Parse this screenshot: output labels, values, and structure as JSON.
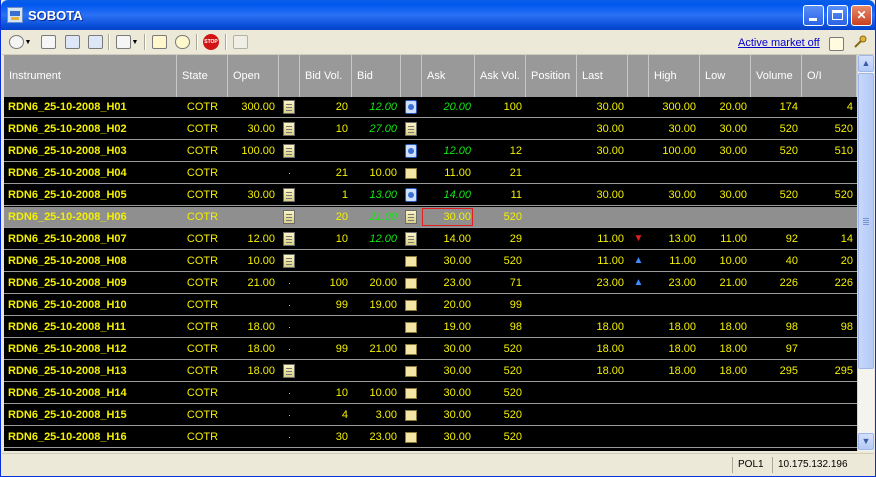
{
  "window": {
    "title": "SOBOTA"
  },
  "toolbar": {
    "active_market_link": "Active market off"
  },
  "columns": [
    "Instrument",
    "State",
    "Open",
    "",
    "Bid Vol.",
    "Bid",
    "",
    "Ask",
    "Ask Vol.",
    "Position",
    "Last",
    "",
    "High",
    "Low",
    "Volume",
    "O/I"
  ],
  "rows": [
    {
      "instrument": "RDN6_25-10-2008_H01",
      "state": "COTR",
      "open": "300.00",
      "open_icon": "doc",
      "bid_vol": "20",
      "bid": "12.00",
      "bid_green": true,
      "bid_icon": "binoc",
      "ask": "20.00",
      "ask_green": true,
      "ask_vol": "100",
      "position": "",
      "last": "30.00",
      "arrow": "",
      "high": "300.00",
      "low": "20.00",
      "volume": "174",
      "oi": "4"
    },
    {
      "instrument": "RDN6_25-10-2008_H02",
      "state": "COTR",
      "open": "30.00",
      "open_icon": "doc",
      "bid_vol": "10",
      "bid": "27.00",
      "bid_green": true,
      "bid_icon": "doc",
      "ask": "",
      "ask_green": false,
      "ask_vol": "",
      "position": "",
      "last": "30.00",
      "arrow": "",
      "high": "30.00",
      "low": "30.00",
      "volume": "520",
      "oi": "520"
    },
    {
      "instrument": "RDN6_25-10-2008_H03",
      "state": "COTR",
      "open": "100.00",
      "open_icon": "doc",
      "bid_vol": "",
      "bid": "",
      "bid_green": false,
      "bid_icon": "binoc",
      "ask": "12.00",
      "ask_green": true,
      "ask_vol": "12",
      "position": "",
      "last": "30.00",
      "arrow": "",
      "high": "100.00",
      "low": "30.00",
      "volume": "520",
      "oi": "510"
    },
    {
      "instrument": "RDN6_25-10-2008_H04",
      "state": "COTR",
      "open": "",
      "open_icon": "dot",
      "bid_vol": "21",
      "bid": "10.00",
      "bid_green": false,
      "bid_icon": "folder",
      "ask": "11.00",
      "ask_green": false,
      "ask_vol": "21",
      "position": "",
      "last": "",
      "arrow": "",
      "high": "",
      "low": "",
      "volume": "",
      "oi": ""
    },
    {
      "instrument": "RDN6_25-10-2008_H05",
      "state": "COTR",
      "open": "30.00",
      "open_icon": "doc",
      "bid_vol": "1",
      "bid": "13.00",
      "bid_green": true,
      "bid_icon": "binoc",
      "ask": "14.00",
      "ask_green": true,
      "ask_vol": "11",
      "position": "",
      "last": "30.00",
      "arrow": "",
      "high": "30.00",
      "low": "30.00",
      "volume": "520",
      "oi": "520"
    },
    {
      "instrument": "RDN6_25-10-2008_H06",
      "state": "COTR",
      "open": "",
      "open_icon": "doc",
      "bid_vol": "20",
      "bid": "21.00",
      "bid_green": true,
      "bid_icon": "doc",
      "ask": "30.00",
      "ask_green": false,
      "ask_vol": "520",
      "position": "",
      "last": "",
      "arrow": "",
      "high": "",
      "low": "",
      "volume": "",
      "oi": "",
      "selected": true
    },
    {
      "instrument": "RDN6_25-10-2008_H07",
      "state": "COTR",
      "open": "12.00",
      "open_icon": "doc",
      "bid_vol": "10",
      "bid": "12.00",
      "bid_green": true,
      "bid_icon": "doc",
      "ask": "14.00",
      "ask_green": false,
      "ask_vol": "29",
      "position": "",
      "last": "11.00",
      "arrow": "down",
      "high": "13.00",
      "low": "11.00",
      "volume": "92",
      "oi": "14"
    },
    {
      "instrument": "RDN6_25-10-2008_H08",
      "state": "COTR",
      "open": "10.00",
      "open_icon": "doc",
      "bid_vol": "",
      "bid": "",
      "bid_green": false,
      "bid_icon": "folder",
      "ask": "30.00",
      "ask_green": false,
      "ask_vol": "520",
      "position": "",
      "last": "11.00",
      "arrow": "up",
      "high": "11.00",
      "low": "10.00",
      "volume": "40",
      "oi": "20"
    },
    {
      "instrument": "RDN6_25-10-2008_H09",
      "state": "COTR",
      "open": "21.00",
      "open_icon": "dot",
      "bid_vol": "100",
      "bid": "20.00",
      "bid_green": false,
      "bid_icon": "folder",
      "ask": "23.00",
      "ask_green": false,
      "ask_vol": "71",
      "position": "",
      "last": "23.00",
      "arrow": "up",
      "high": "23.00",
      "low": "21.00",
      "volume": "226",
      "oi": "226"
    },
    {
      "instrument": "RDN6_25-10-2008_H10",
      "state": "COTR",
      "open": "",
      "open_icon": "dot",
      "bid_vol": "99",
      "bid": "19.00",
      "bid_green": false,
      "bid_icon": "folder",
      "ask": "20.00",
      "ask_green": false,
      "ask_vol": "99",
      "position": "",
      "last": "",
      "arrow": "",
      "high": "",
      "low": "",
      "volume": "",
      "oi": ""
    },
    {
      "instrument": "RDN6_25-10-2008_H11",
      "state": "COTR",
      "open": "18.00",
      "open_icon": "dot",
      "bid_vol": "",
      "bid": "",
      "bid_green": false,
      "bid_icon": "folder",
      "ask": "19.00",
      "ask_green": false,
      "ask_vol": "98",
      "position": "",
      "last": "18.00",
      "arrow": "",
      "high": "18.00",
      "low": "18.00",
      "volume": "98",
      "oi": "98"
    },
    {
      "instrument": "RDN6_25-10-2008_H12",
      "state": "COTR",
      "open": "18.00",
      "open_icon": "dot",
      "bid_vol": "99",
      "bid": "21.00",
      "bid_green": false,
      "bid_icon": "folder",
      "ask": "30.00",
      "ask_green": false,
      "ask_vol": "520",
      "position": "",
      "last": "18.00",
      "arrow": "",
      "high": "18.00",
      "low": "18.00",
      "volume": "97",
      "oi": ""
    },
    {
      "instrument": "RDN6_25-10-2008_H13",
      "state": "COTR",
      "open": "18.00",
      "open_icon": "doc",
      "bid_vol": "",
      "bid": "",
      "bid_green": false,
      "bid_icon": "folder",
      "ask": "30.00",
      "ask_green": false,
      "ask_vol": "520",
      "position": "",
      "last": "18.00",
      "arrow": "",
      "high": "18.00",
      "low": "18.00",
      "volume": "295",
      "oi": "295"
    },
    {
      "instrument": "RDN6_25-10-2008_H14",
      "state": "COTR",
      "open": "",
      "open_icon": "dot",
      "bid_vol": "10",
      "bid": "10.00",
      "bid_green": false,
      "bid_icon": "folder",
      "ask": "30.00",
      "ask_green": false,
      "ask_vol": "520",
      "position": "",
      "last": "",
      "arrow": "",
      "high": "",
      "low": "",
      "volume": "",
      "oi": ""
    },
    {
      "instrument": "RDN6_25-10-2008_H15",
      "state": "COTR",
      "open": "",
      "open_icon": "dot",
      "bid_vol": "4",
      "bid": "3.00",
      "bid_green": false,
      "bid_icon": "folder",
      "ask": "30.00",
      "ask_green": false,
      "ask_vol": "520",
      "position": "",
      "last": "",
      "arrow": "",
      "high": "",
      "low": "",
      "volume": "",
      "oi": ""
    },
    {
      "instrument": "RDN6_25-10-2008_H16",
      "state": "COTR",
      "open": "",
      "open_icon": "dot",
      "bid_vol": "30",
      "bid": "23.00",
      "bid_green": false,
      "bid_icon": "folder",
      "ask": "30.00",
      "ask_green": false,
      "ask_vol": "520",
      "position": "",
      "last": "",
      "arrow": "",
      "high": "",
      "low": "",
      "volume": "",
      "oi": ""
    }
  ],
  "status": {
    "user": "POL1",
    "ip": "10.175.132.196"
  },
  "colors": {
    "text": "#f3f000",
    "green": "#14e614",
    "header_bg": "#999999",
    "selected_row": "#8f8f8f"
  }
}
